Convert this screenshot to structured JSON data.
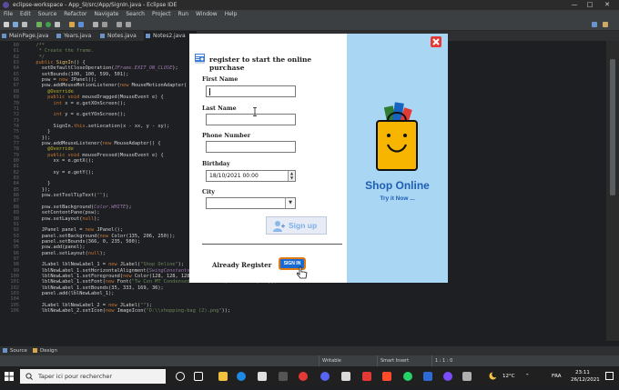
{
  "window": {
    "title": "eclipse-workspace - App_SI/src/App/SignIn.java - Eclipse IDE",
    "controls": [
      "—",
      "□",
      "✕"
    ]
  },
  "menu": [
    "File",
    "Edit",
    "Source",
    "Refactor",
    "Navigate",
    "Search",
    "Project",
    "Run",
    "Window",
    "Help"
  ],
  "tabs": [
    "MainPage.java",
    "Years.java",
    "Notes.java",
    "Notes2.java"
  ],
  "code_lines": [
    {
      "n": "60",
      "html": "<span class='cm'>  /**</span>"
    },
    {
      "n": "61",
      "html": "<span class='cm'>   * Create the frame.</span>"
    },
    {
      "n": "62",
      "html": "<span class='cm'>   */</span>"
    },
    {
      "n": "63",
      "html": "  <span class='kw'>public</span> <span class='fn'>SignIn</span>() {"
    },
    {
      "n": "64",
      "html": "    setDefaultCloseOperation(<span class='cn'>JFrame.EXIT_ON_CLOSE</span>);"
    },
    {
      "n": "65",
      "html": "    setBounds(100, 100, 599, 501);"
    },
    {
      "n": "66",
      "html": "    psw = <span class='kw'>new</span> JPanel();"
    },
    {
      "n": "67",
      "html": "    psw.addMouseMotionListener(<span class='kw'>new</span> MouseMotionAdapter("
    },
    {
      "n": "68",
      "html": "      <span class='an'>@Override</span>"
    },
    {
      "n": "69",
      "html": "      <span class='kw'>public void</span> mouseDragged(MouseEvent e) {"
    },
    {
      "n": "70",
      "html": "        <span class='kw'>int</span> x = e.getXOnScreen();"
    },
    {
      "n": "71",
      "html": ""
    },
    {
      "n": "72",
      "html": "        <span class='kw'>int</span> y = e.getYOnScreen();"
    },
    {
      "n": "73",
      "html": ""
    },
    {
      "n": "74",
      "html": "        SignIn.<span class='kw'>this</span>.setLocation(x - xx, y - xy);"
    },
    {
      "n": "75",
      "html": "      }"
    },
    {
      "n": "76",
      "html": "    });"
    },
    {
      "n": "77",
      "html": "    psw.addMouseListener(<span class='kw'>new</span> MouseAdapter() {"
    },
    {
      "n": "78",
      "html": "      <span class='an'>@Override</span>"
    },
    {
      "n": "79",
      "html": "      <span class='kw'>public void</span> mousePressed(MouseEvent e) {"
    },
    {
      "n": "80",
      "html": "        xx = e.getX();"
    },
    {
      "n": "81",
      "html": ""
    },
    {
      "n": "82",
      "html": "        xy = e.getY();"
    },
    {
      "n": "83",
      "html": ""
    },
    {
      "n": "84",
      "html": "      }"
    },
    {
      "n": "85",
      "html": "    });"
    },
    {
      "n": "86",
      "html": "    psw.setToolTipText(<span class='st'>\"\"</span>);"
    },
    {
      "n": "87",
      "html": ""
    },
    {
      "n": "88",
      "html": "    psw.setBackground(<span class='cn'>Color.WHITE</span>);"
    },
    {
      "n": "89",
      "html": "    setContentPane(psw);"
    },
    {
      "n": "90",
      "html": "    psw.setLayout(<span class='kw'>null</span>);"
    },
    {
      "n": "91",
      "html": ""
    },
    {
      "n": "92",
      "html": "    JPanel panel = <span class='kw'>new</span> JPanel();"
    },
    {
      "n": "93",
      "html": "    panel.setBackground(<span class='kw'>new</span> Color(135, 206, 250));"
    },
    {
      "n": "94",
      "html": "    panel.setBounds(366, 0, 235, 500);"
    },
    {
      "n": "95",
      "html": "    psw.add(panel);"
    },
    {
      "n": "96",
      "html": "    panel.setLayout(<span class='kw'>null</span>);"
    },
    {
      "n": "97",
      "html": ""
    },
    {
      "n": "98",
      "html": "    JLabel lblNewLabel_1 = <span class='kw'>new</span> JLabel(<span class='st'>\"Shop Online\"</span>);"
    },
    {
      "n": "99",
      "html": "    lblNewLabel_1.setHorizontalAlignment(<span class='cn'>SwingConstants.CENTER</span>);"
    },
    {
      "n": "100",
      "html": "    lblNewLabel_1.setForeground(<span class='kw'>new</span> Color(128, 128, 128));"
    },
    {
      "n": "101",
      "html": "    lblNewLabel_1.setFont(<span class='kw'>new</span> Font(<span class='st'>\"Tw Cen MT Condensed Extra Bold\"</span>, <span class='cn'>Font.BOLD</span>, 33));"
    },
    {
      "n": "102",
      "html": "    lblNewLabel_1.setBounds(35, 333, 169, 36);"
    },
    {
      "n": "103",
      "html": "    panel.add(lblNewLabel_1);"
    },
    {
      "n": "104",
      "html": ""
    },
    {
      "n": "105",
      "html": "    JLabel lblNewLabel_2 = <span class='kw'>new</span> JLabel(<span class='st'>\"\"</span>);"
    },
    {
      "n": "106",
      "html": "    lblNewLabel_2.setIcon(<span class='kw'>new</span> ImageIcon(<span class='st'>\"D:\\\\shopping-bag (2).png\"</span>));"
    }
  ],
  "bottom_tabs": [
    "Source",
    "Design"
  ],
  "status": {
    "writable": "Writable",
    "insert": "Smart Insert",
    "position": "1 : 1 : 0"
  },
  "taskbar": {
    "search_placeholder": "Taper ici pour rechercher",
    "temperature": "12°C",
    "language": "FRA",
    "time": "23:11",
    "date": "26/12/2021"
  },
  "dialog": {
    "title": "register to start the online purchase",
    "first_name_label": "First Name",
    "last_name_label": "Last Name",
    "phone_label": "Phone Number",
    "birthday_label": "Birthday",
    "birthday_value": "18/10/2021 00:00",
    "city_label": "City",
    "signup_label": "Sign up",
    "already_label": "Already Register",
    "signin_label": "SIGN IN",
    "shop_label": "Shop Online",
    "tryit_label": "Try it Now ...",
    "panel_color": "#a9d6f3",
    "shop_color": "#1e5db5"
  }
}
